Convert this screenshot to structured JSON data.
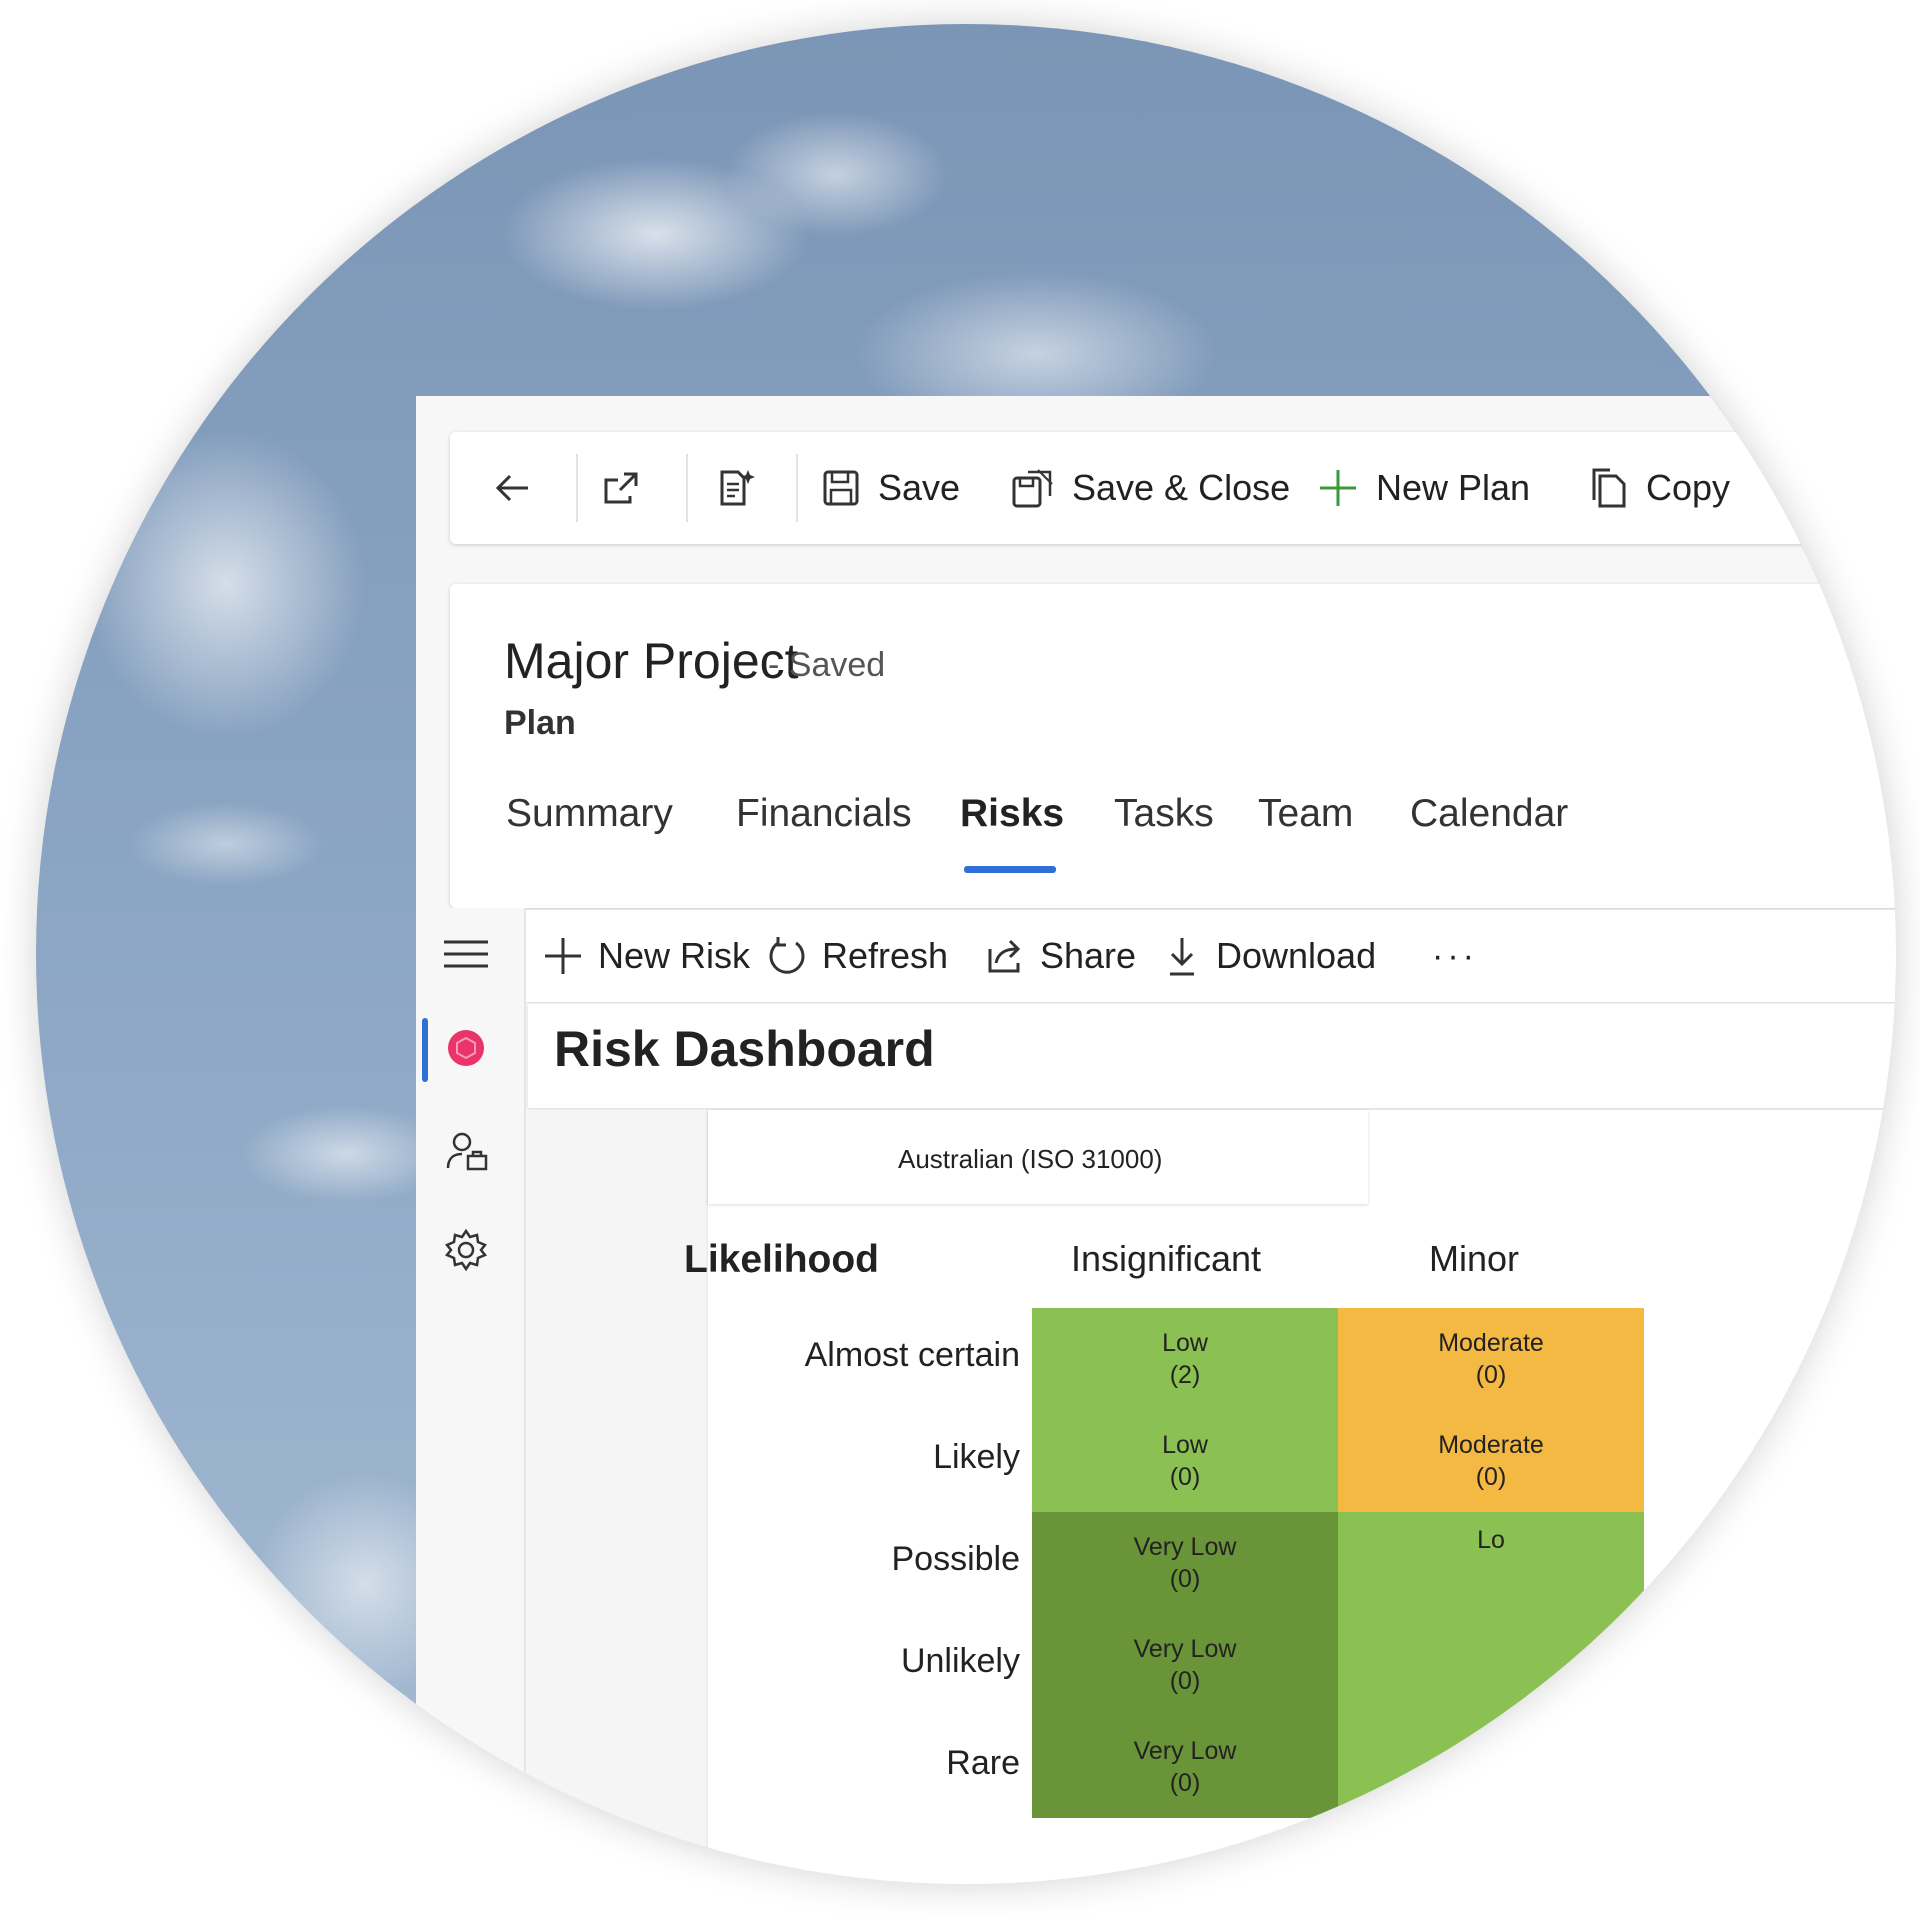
{
  "command_bar": {
    "save": "Save",
    "save_close": "Save & Close",
    "new_plan": "New Plan",
    "copy": "Copy"
  },
  "header": {
    "title": "Major Project",
    "status": "- Saved",
    "entity": "Plan",
    "tabs": [
      "Summary",
      "Financials",
      "Risks",
      "Tasks",
      "Team",
      "Calendar"
    ],
    "active_tab": "Risks"
  },
  "toolbar": {
    "new_risk": "New Risk",
    "refresh": "Refresh",
    "share": "Share",
    "download": "Download",
    "more": "···"
  },
  "dashboard": {
    "title": "Risk Dashboard",
    "framework": "Australian (ISO 31000)",
    "likelihood_label": "Likelihood",
    "consequence_columns": [
      "Insignificant",
      "Minor"
    ],
    "likelihood_rows": [
      "Almost certain",
      "Likely",
      "Possible",
      "Unlikely",
      "Rare"
    ],
    "matrix": [
      [
        {
          "level": "Low",
          "count": "(2)"
        },
        {
          "level": "Moderate",
          "count": "(0)"
        }
      ],
      [
        {
          "level": "Low",
          "count": "(0)"
        },
        {
          "level": "Moderate",
          "count": "(0)"
        }
      ],
      [
        {
          "level": "Very Low",
          "count": "(0)"
        },
        {
          "level": "Lo",
          "count": ""
        }
      ],
      [
        {
          "level": "Very Low",
          "count": "(0)"
        },
        {
          "level": "",
          "count": ""
        }
      ],
      [
        {
          "level": "Very Low",
          "count": "(0)"
        },
        {
          "level": "",
          "count": ""
        }
      ]
    ],
    "colors": {
      "very_low": "#6a9438",
      "low": "#8bc152",
      "moderate": "#f4b942",
      "accent": "#2f6fd6",
      "nav_icon": "#e8336b"
    }
  }
}
